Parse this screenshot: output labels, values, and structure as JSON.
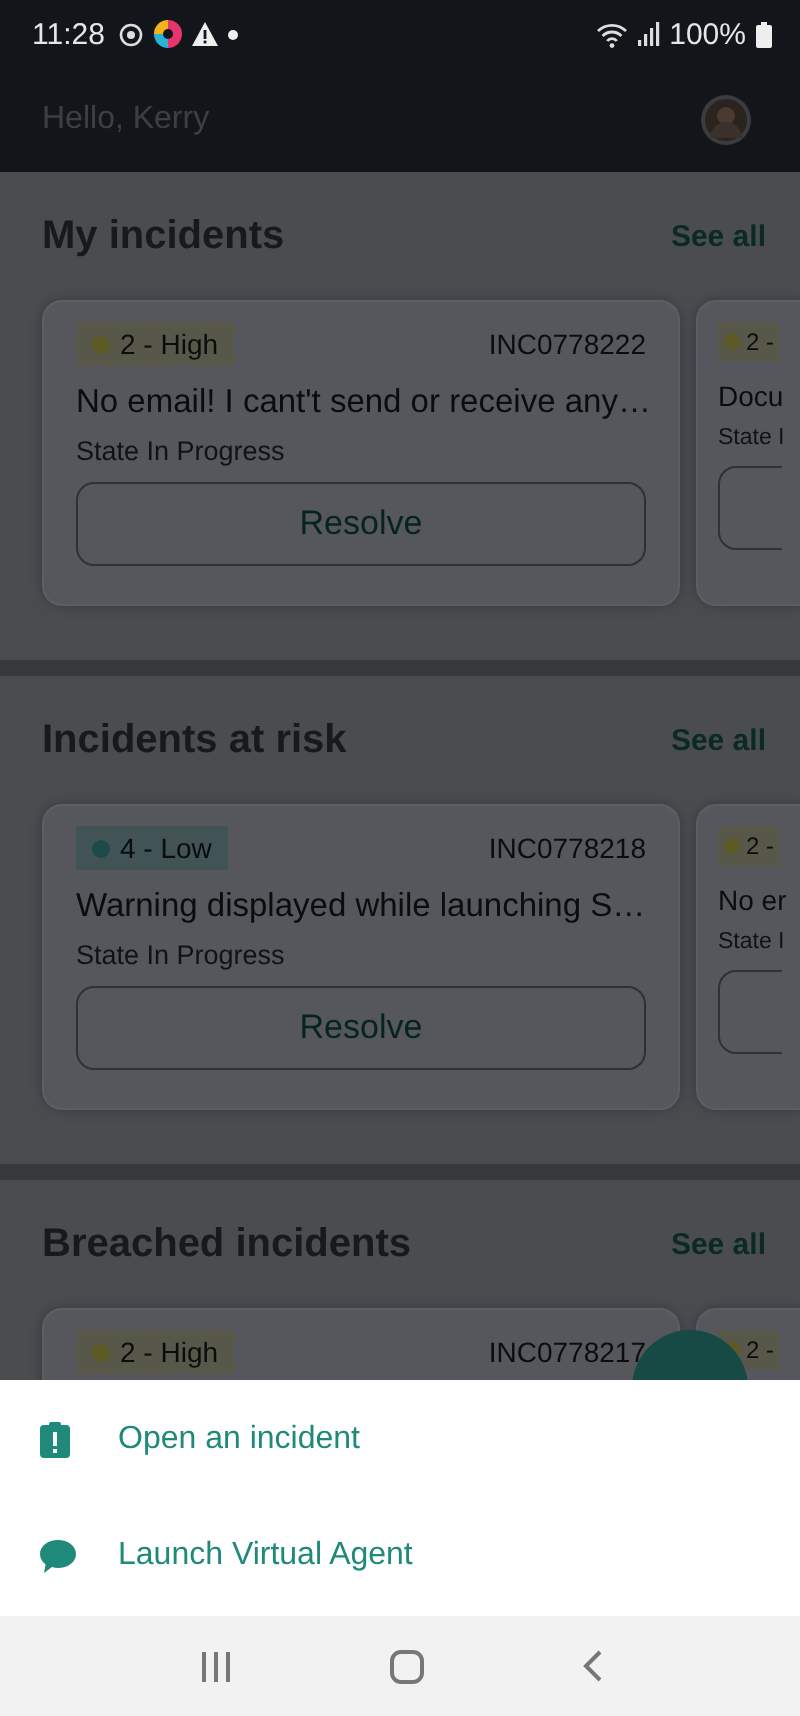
{
  "status_bar": {
    "time": "11:28",
    "battery": "100%"
  },
  "header": {
    "greeting": "Hello, Kerry"
  },
  "sections": [
    {
      "title": "My incidents",
      "action": "See all",
      "cards": [
        {
          "kind": "full",
          "priority": "2 - High",
          "color": "#5e5a26",
          "number": "INC0778222",
          "title": "No email! I cant't send or receive any…",
          "state": "State In Progress",
          "button": "Resolve"
        },
        {
          "kind": "partial",
          "priority": "2 -",
          "color": "#5e5a26",
          "title": "Docu",
          "state": "State I"
        }
      ]
    },
    {
      "title": "Incidents at risk",
      "action": "See all",
      "cards": [
        {
          "kind": "full",
          "priority": "4 - Low",
          "color": "#1e4b4a",
          "number": "INC0778218",
          "title": "Warning displayed while launching S…",
          "state": "State In Progress",
          "button": "Resolve"
        },
        {
          "kind": "partial",
          "priority": "2 -",
          "color": "#5e5a26",
          "title": "No er",
          "state": "State I"
        }
      ]
    },
    {
      "title": "Breached incidents",
      "action": "See all",
      "cards": [
        {
          "kind": "full",
          "priority": "2 - High",
          "color": "#5e5a26",
          "number": "INC0778217"
        },
        {
          "kind": "partial",
          "priority": "2 -",
          "color": "#5e5a26"
        }
      ]
    }
  ],
  "sheet": {
    "items": [
      {
        "kind": "incident",
        "label": "Open an incident"
      },
      {
        "kind": "chat",
        "label": "Launch Virtual Agent"
      }
    ]
  }
}
